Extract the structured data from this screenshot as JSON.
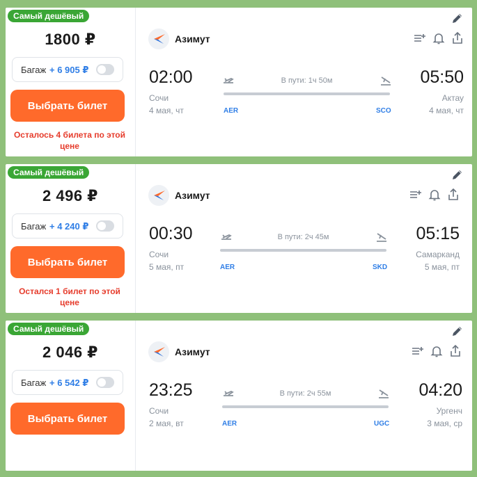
{
  "badge_label": "Самый дешёвый",
  "buy_label": "Выбрать билет",
  "bag_label": "Багаж",
  "colors": {
    "accent": "#ff6a2b",
    "badge": "#3aa635",
    "link": "#2f7ee6",
    "warning": "#e63c2c",
    "frame": "#8fc07a"
  },
  "icons": [
    "airline-logo-icon",
    "add-to-list-icon",
    "bell-icon",
    "share-icon",
    "edit-pencil-icon",
    "takeoff-icon",
    "landing-icon"
  ],
  "flights": [
    {
      "price": "1800 ₽",
      "baggage_price": "+ 6 905 ₽",
      "note": "Осталось 4 билета по этой цене",
      "airline": "Азимут",
      "departure": {
        "time": "02:00",
        "city": "Сочи",
        "date": "4 мая, чт",
        "code": "AER"
      },
      "arrival": {
        "time": "05:50",
        "city": "Актау",
        "date": "4 мая, чт",
        "code": "SCO"
      },
      "duration": "В пути: 1ч 50м"
    },
    {
      "price": "2 496 ₽",
      "baggage_price": "+ 4 240 ₽",
      "note": "Остался 1 билет по этой цене",
      "airline": "Азимут",
      "departure": {
        "time": "00:30",
        "city": "Сочи",
        "date": "5 мая, пт",
        "code": "AER"
      },
      "arrival": {
        "time": "05:15",
        "city": "Самарканд",
        "date": "5 мая, пт",
        "code": "SKD"
      },
      "duration": "В пути: 2ч 45м"
    },
    {
      "price": "2 046 ₽",
      "baggage_price": "+ 6 542 ₽",
      "note": "",
      "airline": "Азимут",
      "departure": {
        "time": "23:25",
        "city": "Сочи",
        "date": "2 мая, вт",
        "code": "AER"
      },
      "arrival": {
        "time": "04:20",
        "city": "Ургенч",
        "date": "3 мая, ср",
        "code": "UGC"
      },
      "duration": "В пути: 2ч 55м"
    }
  ]
}
